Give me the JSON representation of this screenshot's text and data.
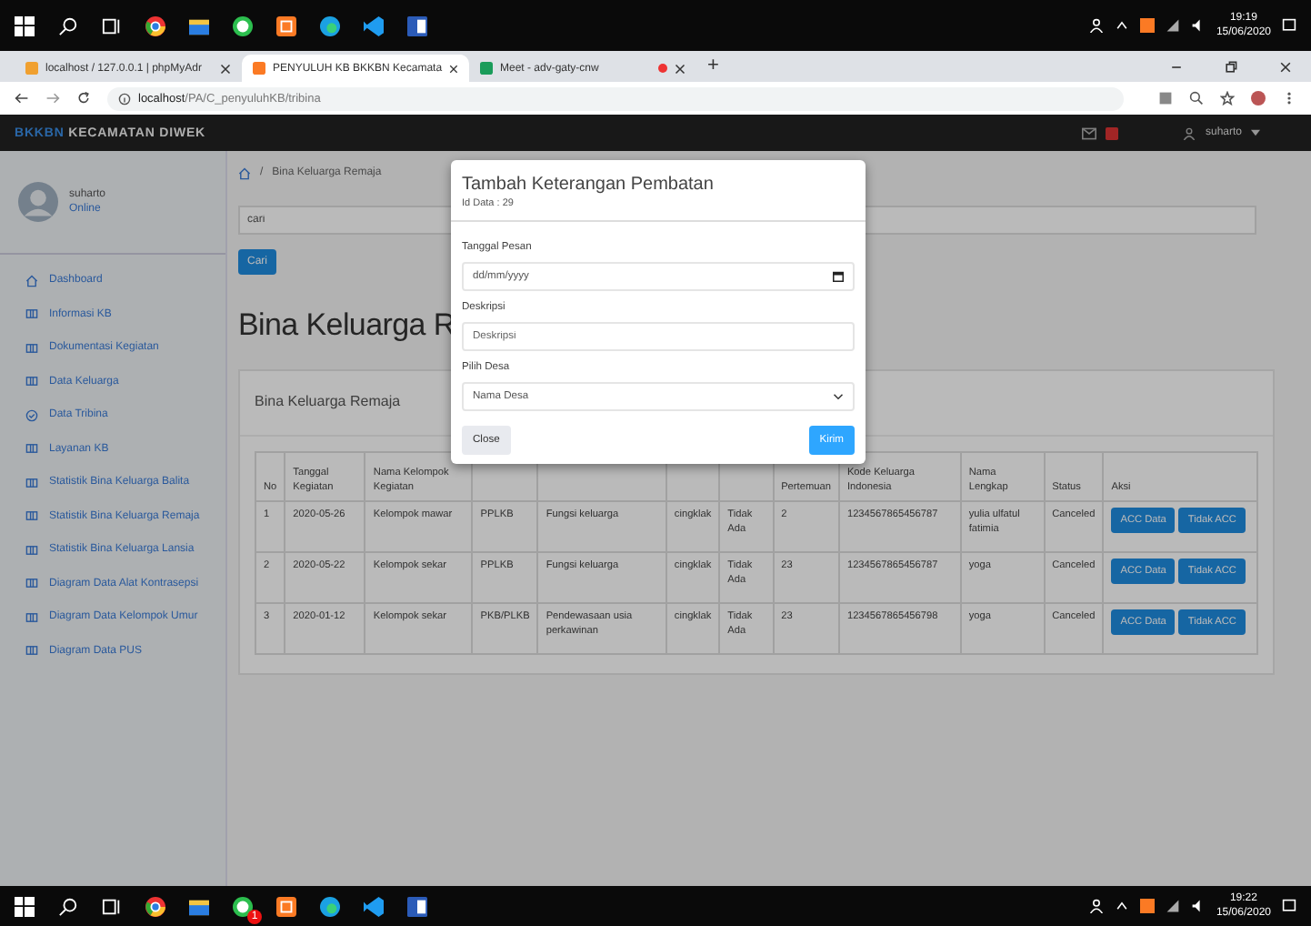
{
  "taskbar_top": {
    "time": "19:19",
    "date": "15/06/2020"
  },
  "browser": {
    "tabs": [
      {
        "title": "localhost / 127.0.0.1 | phpMyAdr",
        "selected": false
      },
      {
        "title": "PENYULUH KB BKKBN Kecamata",
        "selected": true
      },
      {
        "title": "Meet - adv-gaty-cnw",
        "selected": false
      }
    ],
    "new_tab": "+",
    "url_host": "localhost",
    "url_path": "/PA/C_penyuluhKB/tribina"
  },
  "navbar": {
    "brand_accent": "BKKBN",
    "brand": "KECAMATAN DIWEK",
    "user": "suharto"
  },
  "breadcrumb_separator": "/",
  "sidebar": {
    "user_name": "suharto",
    "status": "Online",
    "items": [
      {
        "label": "Dashboard",
        "kind": "home"
      },
      {
        "label": "Informasi KB",
        "kind": "table"
      },
      {
        "label": "Dokumentasi Kegiatan",
        "kind": "table"
      },
      {
        "label": "Data Keluarga",
        "kind": "table"
      },
      {
        "label": "Data Tribina",
        "kind": "circle"
      },
      {
        "label": "Layanan KB",
        "kind": "table"
      },
      {
        "label": "Statistik Bina Keluarga Balita",
        "kind": "table"
      },
      {
        "label": "Statistik Bina Keluarga Remaja",
        "kind": "table"
      },
      {
        "label": "Statistik Bina Keluarga Lansia",
        "kind": "table"
      },
      {
        "label": "Diagram Data Alat Kontrasepsi",
        "kind": "table"
      },
      {
        "label": "Diagram Data Kelompok Umur",
        "kind": "table"
      },
      {
        "label": "Diagram Data PUS",
        "kind": "table"
      }
    ]
  },
  "breadcrumb": "Bina Keluarga Remaja",
  "search": {
    "placeholder": "cari"
  },
  "search_button": "Cari",
  "heading": "Bina Keluarga R",
  "card": {
    "title": "Bina Keluarga Remaja",
    "table": {
      "columns": [
        {
          "label": "No"
        },
        {
          "label": "Tanggal Kegiatan"
        },
        {
          "label": "Nama Kelompok Kegiatan"
        },
        {},
        {},
        {},
        {},
        {
          "label": "Pertemuan"
        },
        {
          "label": "Kode Keluarga Indonesia"
        },
        {
          "label": "Nama Lengkap"
        },
        {
          "label": "Status"
        },
        {
          "label": "Aksi"
        }
      ],
      "rows": [
        {
          "cells": [
            "1",
            "2020-05-26",
            "Kelompok mawar",
            "PPLKB",
            "Fungsi keluarga",
            "cingklak",
            "Tidak Ada",
            "2",
            "1234567865456787",
            "yulia ulfatul fatimia",
            "Canceled"
          ],
          "actions": [
            "ACC Data",
            "Tidak ACC"
          ]
        },
        {
          "cells": [
            "2",
            "2020-05-22",
            "Kelompok sekar",
            "PPLKB",
            "Fungsi keluarga",
            "cingklak",
            "Tidak Ada",
            "23",
            "1234567865456787",
            "yoga",
            "Canceled"
          ],
          "actions": [
            "ACC Data",
            "Tidak ACC"
          ]
        },
        {
          "cells": [
            "3",
            "2020-01-12",
            "Kelompok sekar",
            "PKB/PLKB",
            "Pendewasaan usia perkawinan",
            "cingklak",
            "Tidak Ada",
            "23",
            "1234567865456798",
            "yoga",
            "Canceled"
          ],
          "actions": [
            "ACC Data",
            "Tidak ACC"
          ]
        }
      ]
    }
  },
  "modal": {
    "title": "Tambah Keterangan Pembatan",
    "subtitle": "Id Data : 29",
    "fields": [
      {
        "label": "Tanggal Pesan",
        "kind": "date",
        "placeholder": "dd/mm/yyyy"
      },
      {
        "label": "Deskripsi",
        "kind": "text",
        "placeholder": "Deskripsi"
      },
      {
        "label": "Pilih Desa",
        "kind": "select",
        "value": "Nama Desa"
      }
    ],
    "close_button": "Close",
    "submit_button": "Kirim"
  },
  "taskbar_bottom": {
    "time": "19:22",
    "date": "15/06/2020",
    "badge": "1"
  }
}
